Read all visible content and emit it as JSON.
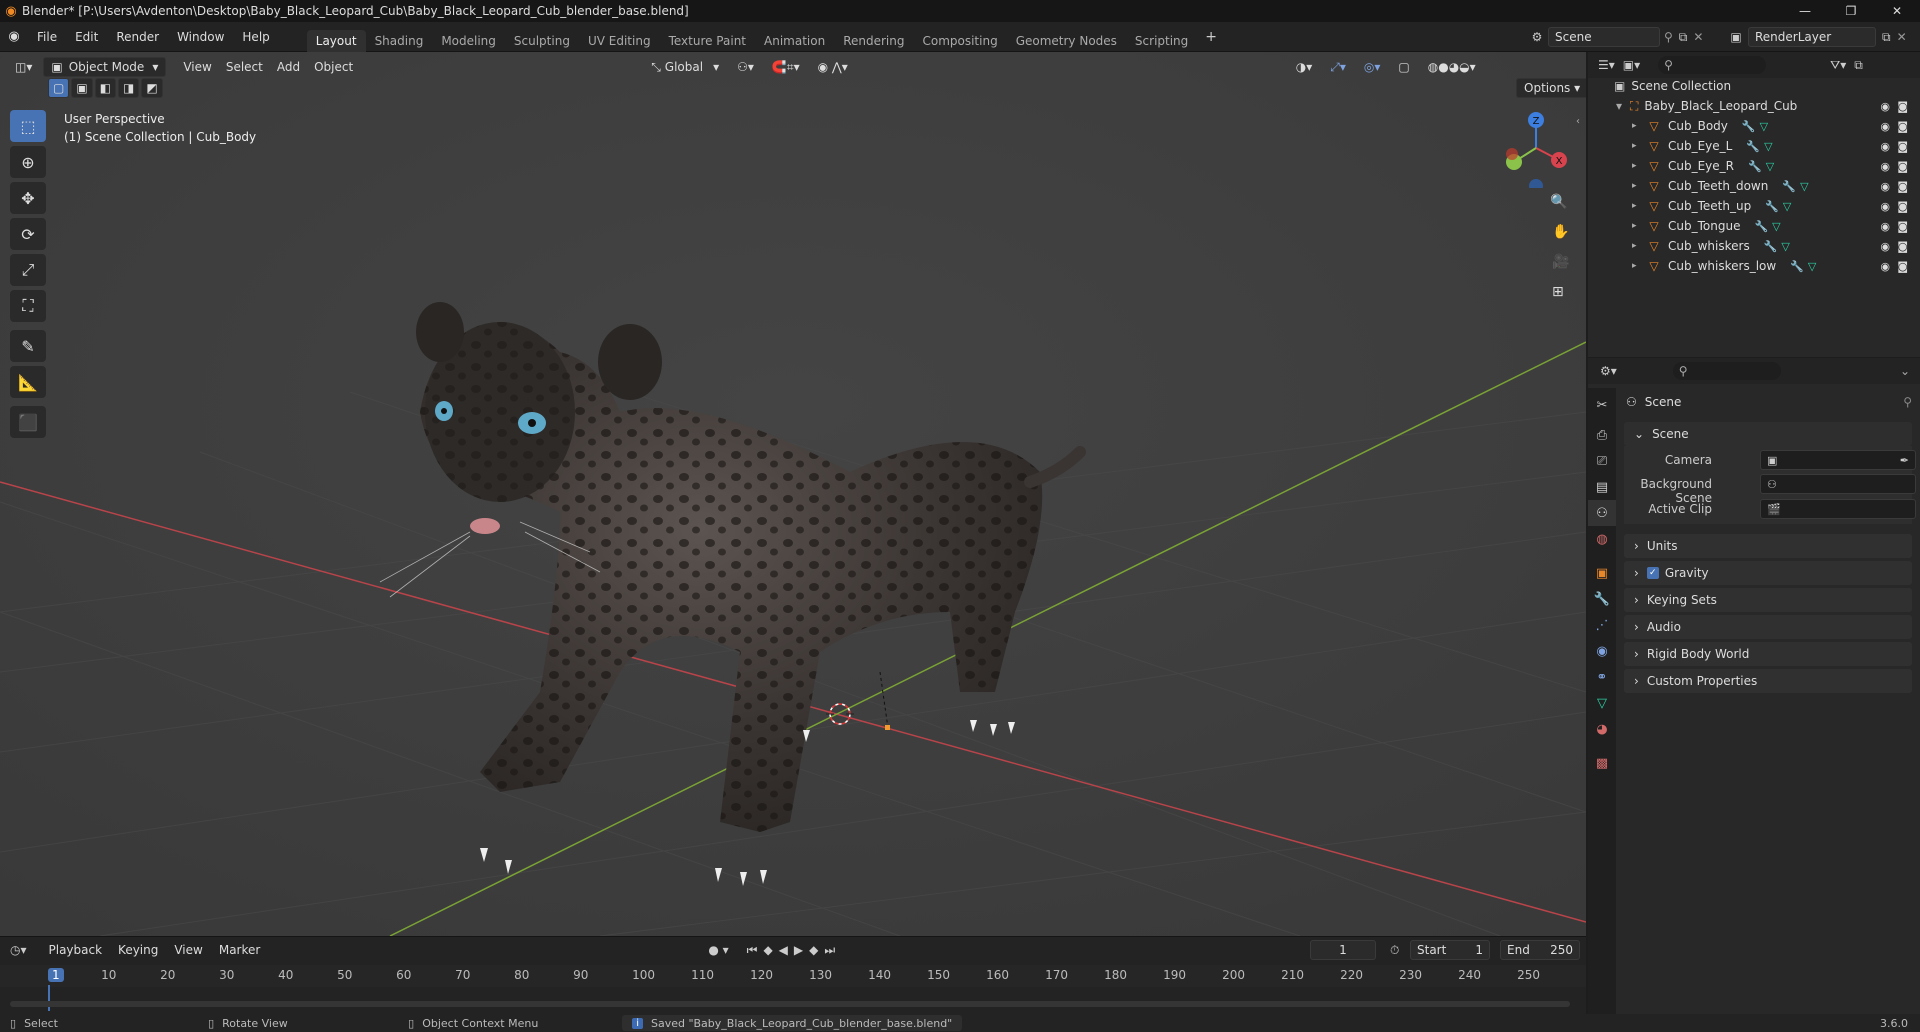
{
  "window": {
    "title": "Blender* [P:\\Users\\Avdenton\\Desktop\\Baby_Black_Leopard_Cub\\Baby_Black_Leopard_Cub_blender_base.blend]",
    "minimize": "—",
    "maximize": "❐",
    "close": "✕"
  },
  "menu": [
    "File",
    "Edit",
    "Render",
    "Window",
    "Help"
  ],
  "workspaces": [
    {
      "label": "Layout",
      "active": true
    },
    {
      "label": "Shading"
    },
    {
      "label": "Modeling"
    },
    {
      "label": "Sculpting"
    },
    {
      "label": "UV Editing"
    },
    {
      "label": "Texture Paint"
    },
    {
      "label": "Animation"
    },
    {
      "label": "Rendering"
    },
    {
      "label": "Compositing"
    },
    {
      "label": "Geometry Nodes"
    },
    {
      "label": "Scripting"
    }
  ],
  "add_workspace": "+",
  "scene_selector": "Scene",
  "view_layer": "RenderLayer",
  "viewport": {
    "mode": "Object Mode",
    "menus": [
      "View",
      "Select",
      "Add",
      "Object"
    ],
    "transform_orientation": "Global",
    "options": "Options",
    "overlay_title": "User Perspective",
    "overlay_context": "(1) Scene Collection | Cub_Body",
    "gizmo": {
      "z": "Z",
      "x": "X",
      "y": "Y"
    }
  },
  "outliner": {
    "root": "Scene Collection",
    "collection": "Baby_Black_Leopard_Cub",
    "objects": [
      "Cub_Body",
      "Cub_Eye_L",
      "Cub_Eye_R",
      "Cub_Teeth_down",
      "Cub_Teeth_up",
      "Cub_Tongue",
      "Cub_whiskers",
      "Cub_whiskers_low"
    ]
  },
  "properties": {
    "context": "Scene",
    "panel": "Scene",
    "camera_label": "Camera",
    "background_label": "Background Scene",
    "clip_label": "Active Clip",
    "collapsed_panels": [
      "Units",
      "Gravity",
      "Keying Sets",
      "Audio",
      "Rigid Body World",
      "Custom Properties"
    ],
    "gravity_checked": true
  },
  "timeline": {
    "menus": [
      "Playback",
      "Keying",
      "View",
      "Marker"
    ],
    "current_frame": "1",
    "start_label": "Start",
    "start": "1",
    "end_label": "End",
    "end": "250",
    "ruler": [
      "1",
      "10",
      "20",
      "30",
      "40",
      "50",
      "60",
      "70",
      "80",
      "90",
      "100",
      "110",
      "120",
      "130",
      "140",
      "150",
      "160",
      "170",
      "180",
      "190",
      "200",
      "210",
      "220",
      "230",
      "240",
      "250"
    ]
  },
  "status": {
    "select": "Select",
    "rotate": "Rotate View",
    "context_menu": "Object Context Menu",
    "message": "Saved \"Baby_Black_Leopard_Cub_blender_base.blend\"",
    "version": "3.6.0"
  },
  "colors": {
    "accent": "#4772b3",
    "object_orange": "#e8862a",
    "mesh_green": "#2cd1a5",
    "x_axis": "#d8434e",
    "y_axis": "#8bc34a",
    "z_axis": "#3d7fe0"
  }
}
